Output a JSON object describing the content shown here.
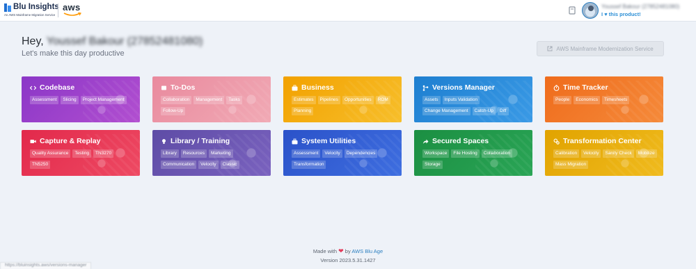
{
  "header": {
    "logo_name": "Blu Insights",
    "logo_sub": "An AWS Mainframe Migration Service",
    "aws_word": "aws",
    "user_name": "Youssef Bakour (27852481080)",
    "love_prefix": "I",
    "love_suffix": "this product!"
  },
  "greeting": {
    "prefix": "Hey,",
    "name": "Youssef Bakour (27852481080)",
    "subtitle": "Let's make this day productive"
  },
  "external_button": {
    "label": "AWS Mainframe Modernization Service"
  },
  "tiles": [
    {
      "title": "Codebase",
      "icon": "code-icon",
      "tags": [
        "Assessment",
        "Slicing",
        "Project Management"
      ]
    },
    {
      "title": "To-Dos",
      "icon": "todo-icon",
      "tags": [
        "Collaboration",
        "Management",
        "Tasks",
        "Follow-Up"
      ]
    },
    {
      "title": "Business",
      "icon": "briefcase-icon",
      "tags": [
        "Estimates",
        "Pipelines",
        "Opportunities",
        "ROM",
        "Planning"
      ]
    },
    {
      "title": "Versions Manager",
      "icon": "versions-icon",
      "tags": [
        "Assets",
        "Inputs Validation",
        "Change Management",
        "Catch-Up",
        "Diff"
      ]
    },
    {
      "title": "Time Tracker",
      "icon": "stopwatch-icon",
      "tags": [
        "People",
        "Economics",
        "Timesheets"
      ]
    },
    {
      "title": "Capture & Replay",
      "icon": "video-icon",
      "tags": [
        "Quality Assurance",
        "Testing",
        "TN3270",
        "TN5250"
      ]
    },
    {
      "title": "Library / Training",
      "icon": "lightbulb-icon",
      "tags": [
        "Library",
        "Resources",
        "Marketing",
        "Communication",
        "Velocity",
        "Classic"
      ]
    },
    {
      "title": "System Utilities",
      "icon": "toolbox-icon",
      "tags": [
        "Assessment",
        "Velocity",
        "Dependencies",
        "Transformation"
      ]
    },
    {
      "title": "Secured Spaces",
      "icon": "share-icon",
      "tags": [
        "Workspace",
        "File Hosting",
        "Collaboration",
        "Storage"
      ]
    },
    {
      "title": "Transformation Center",
      "icon": "cogs-icon",
      "tags": [
        "Calibration",
        "Velocity",
        "Sanity Check",
        "Mobilize",
        "Mass Migration"
      ]
    }
  ],
  "footer": {
    "made_with": "Made with",
    "by": "by",
    "brand": "AWS Blu Age",
    "version": "Version 2023.5.31.1427"
  },
  "status_url": "https://bluinsights.aws/versions-manager"
}
